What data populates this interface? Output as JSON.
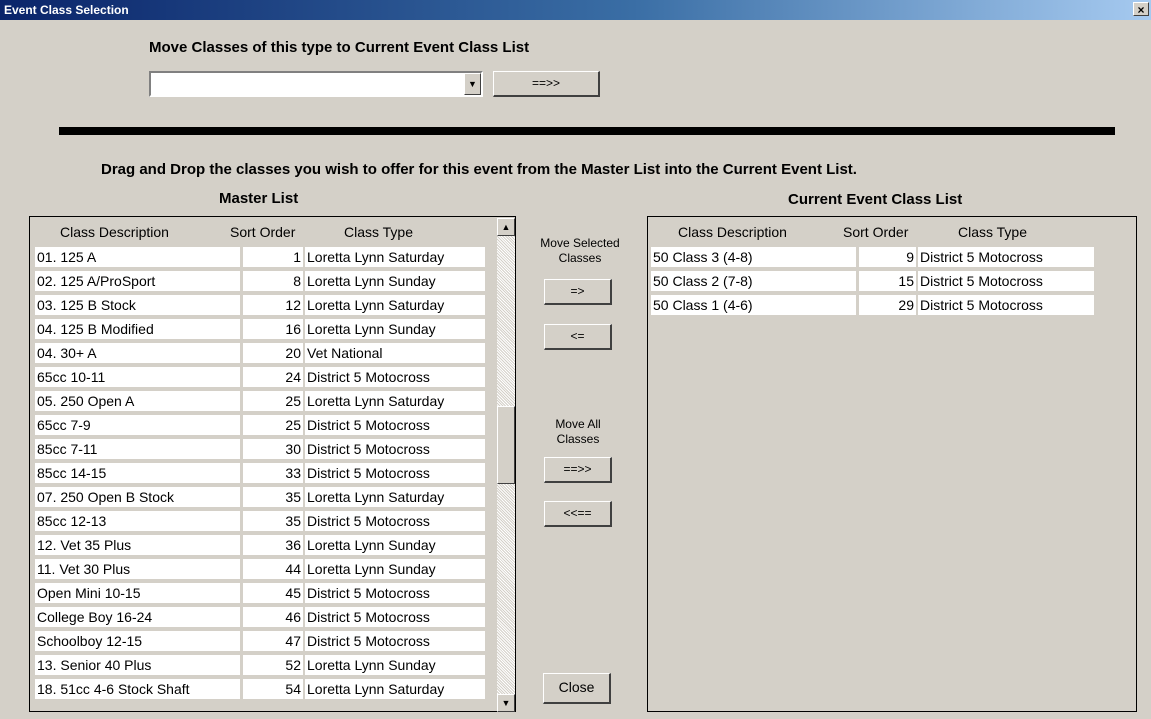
{
  "window": {
    "title": "Event Class Selection",
    "close_glyph": "×"
  },
  "top": {
    "label": "Move Classes of this type to Current Event Class List",
    "combo_value": "",
    "combo_arrow": "▼",
    "move_button": "==>>"
  },
  "instruction": "Drag and Drop the classes you wish to offer for this event from the Master List into the Current Event List.",
  "master": {
    "title": "Master List",
    "headers": {
      "desc": "Class Description",
      "sort": "Sort Order",
      "type": "Class Type"
    },
    "rows": [
      {
        "desc": "01. 125 A",
        "sort": "1",
        "type": "Loretta Lynn Saturday"
      },
      {
        "desc": "02. 125 A/ProSport",
        "sort": "8",
        "type": "Loretta Lynn Sunday"
      },
      {
        "desc": "03. 125 B Stock",
        "sort": "12",
        "type": "Loretta Lynn Saturday"
      },
      {
        "desc": "04. 125 B Modified",
        "sort": "16",
        "type": "Loretta Lynn Sunday"
      },
      {
        "desc": "04. 30+ A",
        "sort": "20",
        "type": "Vet National"
      },
      {
        "desc": "65cc 10-11",
        "sort": "24",
        "type": "District 5 Motocross"
      },
      {
        "desc": "05. 250 Open A",
        "sort": "25",
        "type": "Loretta Lynn Saturday"
      },
      {
        "desc": "65cc 7-9",
        "sort": "25",
        "type": "District 5 Motocross"
      },
      {
        "desc": "85cc 7-11",
        "sort": "30",
        "type": "District 5 Motocross"
      },
      {
        "desc": "85cc 14-15",
        "sort": "33",
        "type": "District 5 Motocross"
      },
      {
        "desc": "07. 250 Open B Stock",
        "sort": "35",
        "type": "Loretta Lynn Saturday"
      },
      {
        "desc": "85cc 12-13",
        "sort": "35",
        "type": "District 5 Motocross"
      },
      {
        "desc": "12. Vet 35 Plus",
        "sort": "36",
        "type": "Loretta Lynn Sunday"
      },
      {
        "desc": "11. Vet 30 Plus",
        "sort": "44",
        "type": "Loretta Lynn Sunday"
      },
      {
        "desc": "Open Mini 10-15",
        "sort": "45",
        "type": "District 5 Motocross"
      },
      {
        "desc": "College Boy 16-24",
        "sort": "46",
        "type": "District 5 Motocross"
      },
      {
        "desc": "Schoolboy 12-15",
        "sort": "47",
        "type": "District 5 Motocross"
      },
      {
        "desc": "13. Senior 40 Plus",
        "sort": "52",
        "type": "Loretta Lynn Sunday"
      },
      {
        "desc": "18. 51cc 4-6 Stock Shaft",
        "sort": "54",
        "type": "Loretta Lynn Saturday"
      }
    ],
    "scroll_up": "▲",
    "scroll_down": "▼"
  },
  "middle": {
    "move_selected_label": "Move Selected Classes",
    "add_selected": "=>",
    "remove_selected": "<=",
    "move_all_label": "Move All Classes",
    "add_all": "==>>",
    "remove_all": "<<==",
    "close": "Close"
  },
  "current": {
    "title": "Current Event Class List",
    "headers": {
      "desc": "Class Description",
      "sort": "Sort Order",
      "type": "Class Type"
    },
    "rows": [
      {
        "desc": "50 Class 3 (4-8)",
        "sort": "9",
        "type": "District 5 Motocross"
      },
      {
        "desc": "50 Class 2 (7-8)",
        "sort": "15",
        "type": "District 5 Motocross"
      },
      {
        "desc": "50 Class 1 (4-6)",
        "sort": "29",
        "type": "District 5 Motocross"
      }
    ]
  }
}
